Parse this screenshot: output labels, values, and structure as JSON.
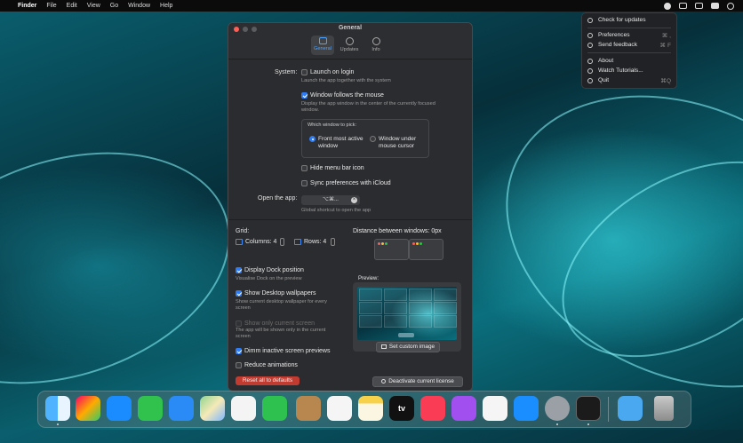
{
  "menubar": {
    "apple_icon": "apple-logo",
    "items": [
      "Finder",
      "File",
      "Edit",
      "View",
      "Go",
      "Window",
      "Help"
    ]
  },
  "dropdown": {
    "items": [
      {
        "label": "Check for updates",
        "icon": "refresh-icon",
        "shortcut": ""
      },
      {
        "label": "Preferences",
        "icon": "sliders-icon",
        "shortcut": "⌘ ,"
      },
      {
        "label": "Send feedback",
        "icon": "message-icon",
        "shortcut": "⌘ F"
      },
      {
        "label": "About",
        "icon": "info-icon",
        "shortcut": ""
      },
      {
        "label": "Watch Tutorials...",
        "icon": "question-icon",
        "shortcut": ""
      },
      {
        "label": "Quit",
        "icon": "power-icon",
        "shortcut": "⌘Q"
      }
    ]
  },
  "window": {
    "title": "General",
    "tabs": [
      {
        "label": "General",
        "active": true
      },
      {
        "label": "Updates",
        "active": false
      },
      {
        "label": "Info",
        "active": false
      }
    ],
    "system_label": "System:",
    "launch_on_login": {
      "label": "Launch on login",
      "desc": "Launch the app together with the system",
      "checked": false
    },
    "window_follows_mouse": {
      "label": "Window follows the mouse",
      "desc": "Display the app window in the center of the currently focused window.",
      "checked": true
    },
    "which_window": {
      "title": "Which window to pick:",
      "options": [
        {
          "label": "Front most active window",
          "selected": true
        },
        {
          "label": "Window under mouse cursor",
          "selected": false
        }
      ]
    },
    "hide_menu_bar_icon": {
      "label": "Hide menu bar icon",
      "checked": false
    },
    "sync_icloud": {
      "label": "Sync preferences with iCloud",
      "checked": false
    },
    "open_app": {
      "label": "Open the app:",
      "shortcut": "⌥⌘...",
      "desc": "Global shortcut to open the app"
    },
    "grid": {
      "label": "Grid:",
      "columns_label": "Columns: 4",
      "rows_label": "Rows: 4"
    },
    "distance_label": "Distance between windows: 0px",
    "display_dock": {
      "label": "Display Dock position",
      "desc": "Visualise Dock on the preview",
      "checked": true
    },
    "show_wallpapers": {
      "label": "Show Desktop wallpapers",
      "desc": "Show current desktop wallpaper for every screen",
      "checked": true
    },
    "show_only_current": {
      "label": "Show only current screen",
      "desc": "The app will be shown only in the current screen",
      "checked": false,
      "disabled": true
    },
    "dimm_inactive": {
      "label": "Dimm inactive screen previews",
      "checked": true
    },
    "reduce_animations": {
      "label": "Reduce animations",
      "checked": false
    },
    "preview_label": "Preview:",
    "set_custom_image": "Set custom image",
    "reset_button": "Reset all to defaults",
    "deactivate_button": "Deactivate current license"
  },
  "dock": {
    "apps": [
      "finder-icon",
      "launchpad-icon",
      "safari-icon",
      "messages-icon",
      "mail-icon",
      "maps-icon",
      "photos-icon",
      "facetime-icon",
      "contacts-icon",
      "reminders-icon",
      "notes-icon",
      "apple-tv-icon",
      "music-icon",
      "podcasts-icon",
      "news-icon",
      "app-store-icon",
      "system-preferences-icon",
      "terminal-icon",
      "downloads-folder-icon",
      "trash-icon"
    ],
    "tv_label": "tv"
  },
  "colors": {
    "accent": "#2f7cf6",
    "reset_red": "#c23b30"
  }
}
